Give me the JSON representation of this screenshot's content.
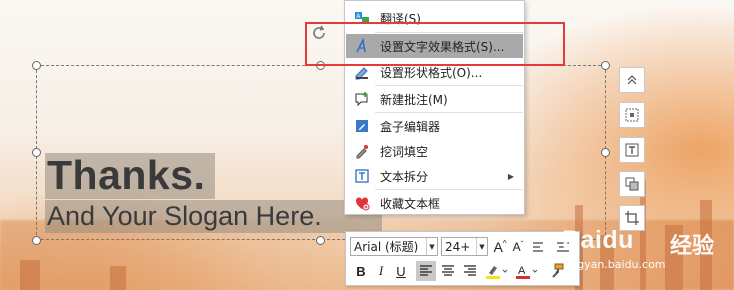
{
  "slide": {
    "title": "Thanks.",
    "slogan": "And Your Slogan Here."
  },
  "context_menu": {
    "items": [
      {
        "label": "翻译(S)",
        "icon": "translate-icon"
      },
      {
        "label": "设置文字效果格式(S)...",
        "icon": "text-effect-icon",
        "active": true
      },
      {
        "label": "设置形状格式(O)...",
        "icon": "shape-format-icon"
      },
      {
        "label": "新建批注(M)",
        "icon": "new-comment-icon"
      },
      {
        "label": "盒子编辑器",
        "icon": "box-editor-icon"
      },
      {
        "label": "挖词填空",
        "icon": "fill-blank-icon"
      },
      {
        "label": "文本拆分",
        "icon": "text-split-icon",
        "has_submenu": true
      },
      {
        "label": "收藏文本框",
        "icon": "favorite-textbox-icon"
      }
    ]
  },
  "mini_toolbar": {
    "font_name": "Arial (标题)",
    "font_size": "24+",
    "grow_font": "A",
    "shrink_font": "A",
    "bold": "B",
    "italic": "I",
    "underline": "U",
    "highlight_color": "#f6e318",
    "font_color": "#d9302c"
  },
  "side_buttons": [
    "layout-options-icon",
    "position-icon",
    "text-box-icon",
    "arrange-icon",
    "crop-icon"
  ],
  "colors": {
    "selection_highlight": "#a9a9a9",
    "callout_red": "#e53a3a"
  },
  "watermark": {
    "brand": "Baidu",
    "brand_cn": "经验",
    "url": "jingyan.baidu.com"
  }
}
